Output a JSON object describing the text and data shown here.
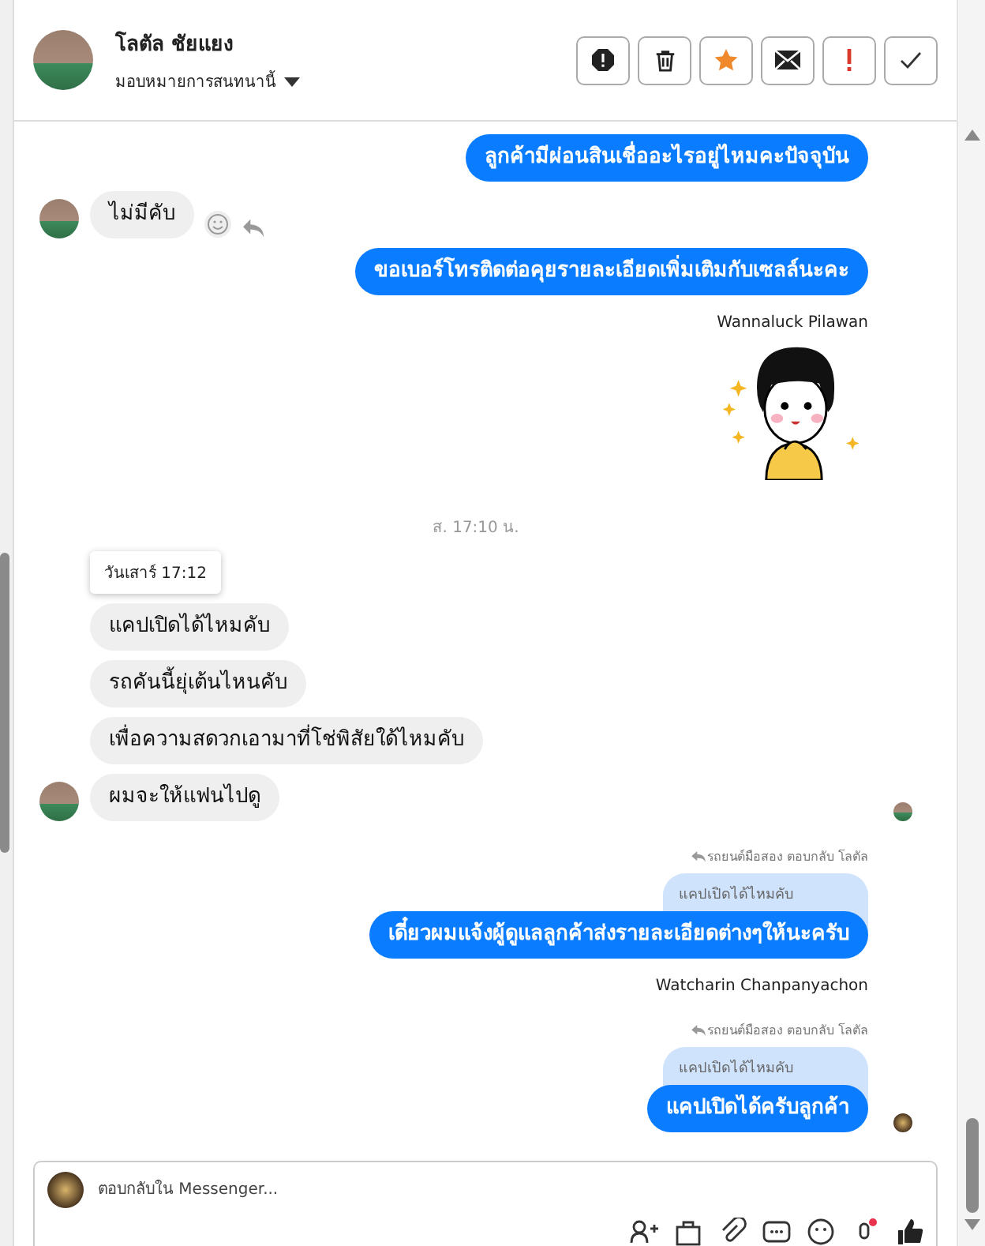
{
  "header": {
    "name": "โลตัล ชัยแยง",
    "assign_label": "มอบหมายการสนทนานี้",
    "actions": [
      {
        "kind": "spam"
      },
      {
        "kind": "trash"
      },
      {
        "kind": "star"
      },
      {
        "kind": "mail"
      },
      {
        "kind": "important"
      },
      {
        "kind": "done"
      }
    ]
  },
  "messages": [
    {
      "kind": "outgoing",
      "text": "ลูกค้ามีผ่อนสินเชื่ออะไรอยู่ไหมคะปัจจุบัน",
      "seen": false
    },
    {
      "kind": "incoming",
      "text": "ไม่มีคับ",
      "avatar": true,
      "actions": true
    },
    {
      "kind": "outgoing",
      "text": "ขอเบอร์โทรติดต่อคุยรายละเอียดเพิ่มเติมกับเซลล์นะคะ",
      "seen": false
    },
    {
      "kind": "sender",
      "text": "Wannaluck Pilawan"
    },
    {
      "kind": "sticker"
    },
    {
      "kind": "time",
      "text": "ส. 17:10 น."
    },
    {
      "kind": "tooltip",
      "text": "วันเสาร์ 17:12"
    },
    {
      "kind": "incoming",
      "text": "แคปเปิดได้ไหมคับ",
      "avatar": false,
      "actions": false
    },
    {
      "kind": "incoming",
      "text": "รถคันนี้ยุ่เต้นไหนคับ",
      "avatar": false,
      "actions": false
    },
    {
      "kind": "incoming",
      "text": "เพื่อความสดวกเอามาที่โช่พิสัยใด้ไหมคับ",
      "avatar": false,
      "actions": false
    },
    {
      "kind": "incoming",
      "text": "ผมจะให้แฟนไปดู",
      "avatar": true,
      "actions": false,
      "seen": true
    },
    {
      "kind": "reply",
      "note": "รถยนต์มือสอง ตอบกลับ โลตัล",
      "quote": "แคปเปิดได้ไหมคับ",
      "text": "เดี๋ยวผมแจ้งผู้ดูแลลูกค้าส่งรายละเอียดต่างๆให้นะครับ",
      "seen": false
    },
    {
      "kind": "sender",
      "text": "Watcharin Chanpanyachon"
    },
    {
      "kind": "reply",
      "note": "รถยนต์มือสอง ตอบกลับ โลตัล",
      "quote": "แคปเปิดได้ไหมคับ",
      "text": "แคปเปิดได้ครับลูกค้า",
      "seen": true
    }
  ],
  "composer": {
    "placeholder": "ตอบกลับใน Messenger..."
  }
}
